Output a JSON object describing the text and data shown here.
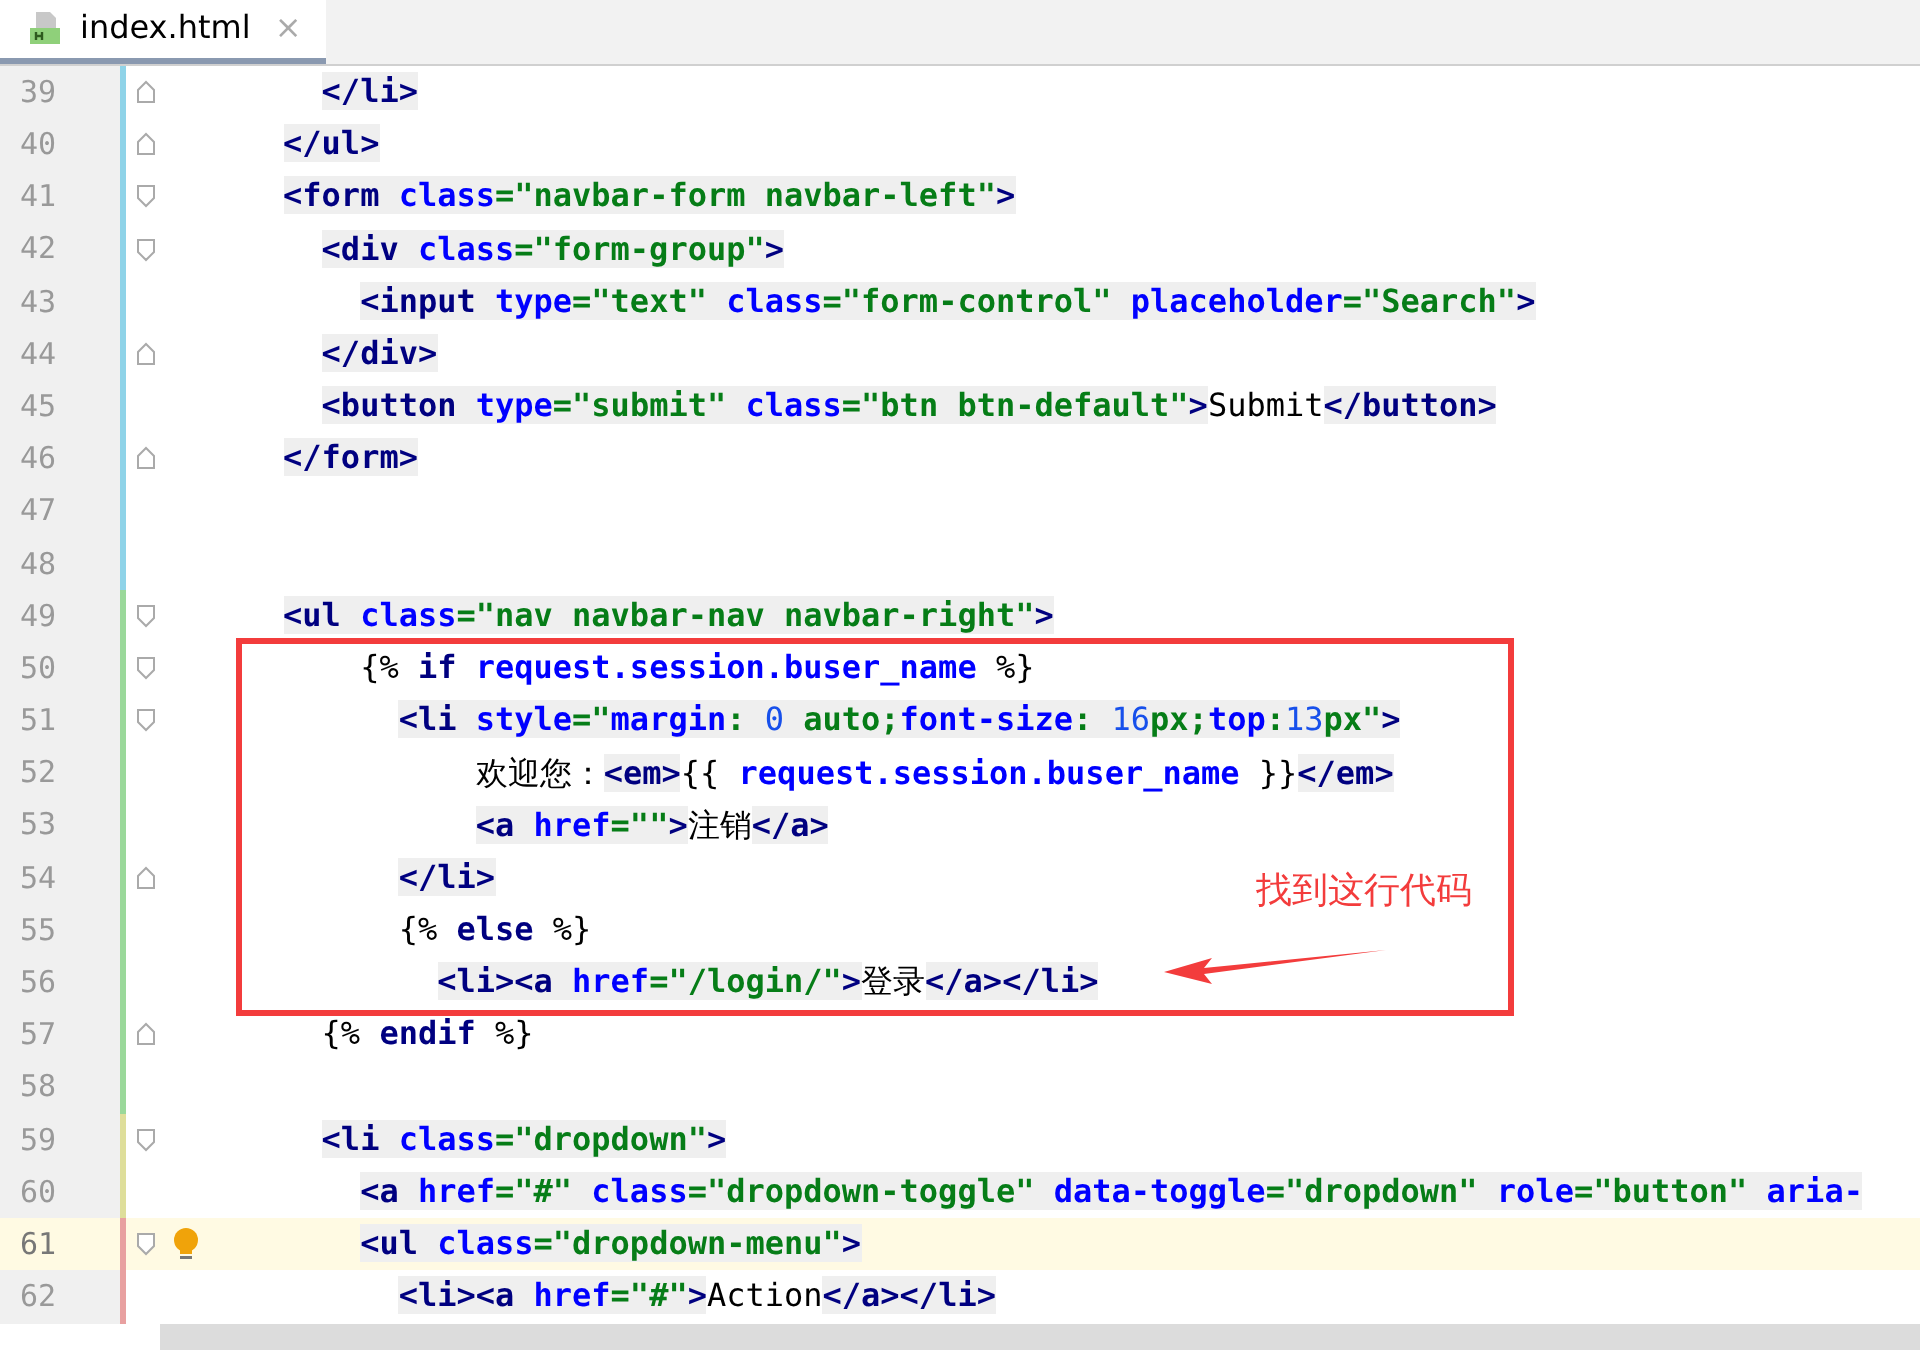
{
  "tab": {
    "title": "index.html",
    "close": "×",
    "selected": true
  },
  "lines": [
    {
      "number": "39",
      "color": "#8fd3e8",
      "kind": "closer",
      "current": false,
      "bulb": false,
      "tokens": [
        {
          "kind": "tag",
          "text": "      </li>"
        }
      ]
    },
    {
      "number": "40",
      "color": "#8fd3e8",
      "kind": "closer",
      "current": false,
      "bulb": false,
      "tokens": [
        {
          "kind": "tag",
          "text": "    </ul>"
        }
      ]
    },
    {
      "number": "41",
      "color": "#8fd3e8",
      "kind": "opener",
      "current": false,
      "bulb": false,
      "tokens": [
        {
          "kind": "tag",
          "text": "    <form"
        },
        {
          "kind": "attr",
          "text": " class"
        },
        {
          "kind": "str",
          "text": "=\"navbar-form navbar-left\""
        },
        {
          "kind": "tag",
          "text": ">"
        }
      ]
    },
    {
      "number": "42",
      "color": "#8fd3e8",
      "kind": "opener",
      "current": false,
      "bulb": false,
      "tokens": [
        {
          "kind": "tag",
          "text": "      <div"
        },
        {
          "kind": "attr",
          "text": " class"
        },
        {
          "kind": "str",
          "text": "=\"form-group\""
        },
        {
          "kind": "tag",
          "text": ">"
        }
      ]
    },
    {
      "number": "43",
      "color": "#8fd3e8",
      "kind": "plain",
      "current": false,
      "bulb": false,
      "tokens": [
        {
          "kind": "tag",
          "text": "        <input"
        },
        {
          "kind": "attr",
          "text": " type"
        },
        {
          "kind": "str",
          "text": "=\"text\""
        },
        {
          "kind": "attr",
          "text": " class"
        },
        {
          "kind": "str",
          "text": "=\"form-control\""
        },
        {
          "kind": "attr",
          "text": " placeholder"
        },
        {
          "kind": "str",
          "text": "=\"Search\""
        },
        {
          "kind": "tag",
          "text": ">"
        }
      ]
    },
    {
      "number": "44",
      "color": "#8fd3e8",
      "kind": "closer",
      "current": false,
      "bulb": false,
      "tokens": [
        {
          "kind": "tag",
          "text": "      </div>"
        }
      ]
    },
    {
      "number": "45",
      "color": "#8fd3e8",
      "kind": "plain",
      "current": false,
      "bulb": false,
      "tokens": [
        {
          "kind": "tag",
          "text": "      <button"
        },
        {
          "kind": "attr",
          "text": " type"
        },
        {
          "kind": "str",
          "text": "=\"submit\""
        },
        {
          "kind": "attr",
          "text": " class"
        },
        {
          "kind": "str",
          "text": "=\"btn btn-default\""
        },
        {
          "kind": "tag",
          "text": ">"
        },
        {
          "kind": "plain",
          "text": "Submit"
        },
        {
          "kind": "tag",
          "text": "</button>"
        }
      ]
    },
    {
      "number": "46",
      "color": "#8fd3e8",
      "kind": "closer",
      "current": false,
      "bulb": false,
      "tokens": [
        {
          "kind": "tag",
          "text": "    </form>"
        }
      ]
    },
    {
      "number": "47",
      "color": "#8fd3e8",
      "kind": "plain",
      "current": false,
      "bulb": false
    },
    {
      "number": "48",
      "color": "#8fd3e8",
      "kind": "plain",
      "current": false,
      "bulb": false
    },
    {
      "number": "49",
      "color": "#9ad89a",
      "kind": "opener",
      "current": false,
      "bulb": false,
      "tokens": [
        {
          "kind": "tag",
          "text": "    <ul"
        },
        {
          "kind": "attr",
          "text": " class"
        },
        {
          "kind": "str",
          "text": "=\"nav navbar-nav navbar-right\""
        },
        {
          "kind": "tag",
          "text": ">"
        }
      ]
    },
    {
      "number": "50",
      "color": "#9ad89a",
      "kind": "opener",
      "current": false,
      "bulb": false,
      "tokens": [
        {
          "kind": "plain",
          "text": "        {% "
        },
        {
          "kind": "kw",
          "text": "if"
        },
        {
          "kind": "var",
          "text": " request.session.buser_name"
        },
        {
          "kind": "plain",
          "text": " %}"
        }
      ]
    },
    {
      "number": "51",
      "color": "#9ad89a",
      "kind": "opener",
      "current": false,
      "bulb": false,
      "tokens": [
        {
          "kind": "tag",
          "text": "          <li"
        },
        {
          "kind": "attr",
          "text": " style"
        },
        {
          "kind": "str",
          "text": "=\""
        },
        {
          "kind": "prop",
          "text": "margin"
        },
        {
          "kind": "str",
          "text": ": "
        },
        {
          "kind": "num",
          "text": "0"
        },
        {
          "kind": "str",
          "text": " auto;"
        },
        {
          "kind": "prop",
          "text": "font-size"
        },
        {
          "kind": "str",
          "text": ": "
        },
        {
          "kind": "num",
          "text": "16"
        },
        {
          "kind": "str",
          "text": "px;"
        },
        {
          "kind": "prop",
          "text": "top"
        },
        {
          "kind": "str",
          "text": ":"
        },
        {
          "kind": "num",
          "text": "13"
        },
        {
          "kind": "str",
          "text": "px\""
        },
        {
          "kind": "tag",
          "text": ">"
        }
      ]
    },
    {
      "number": "52",
      "color": "#9ad89a",
      "kind": "plain",
      "current": false,
      "bulb": false,
      "tokens": [
        {
          "kind": "plain",
          "text": "              欢迎您："
        },
        {
          "kind": "tag",
          "text": "<em>"
        },
        {
          "kind": "plain",
          "text": "{{"
        },
        {
          "kind": "var",
          "text": " request.session.buser_name"
        },
        {
          "kind": "plain",
          "text": " }}"
        },
        {
          "kind": "tag",
          "text": "</em>"
        }
      ]
    },
    {
      "number": "53",
      "color": "#9ad89a",
      "kind": "plain",
      "current": false,
      "bulb": false,
      "tokens": [
        {
          "kind": "tag",
          "text": "              <a"
        },
        {
          "kind": "attr",
          "text": " href"
        },
        {
          "kind": "str",
          "text": "=\"\""
        },
        {
          "kind": "tag",
          "text": ">"
        },
        {
          "kind": "plain",
          "text": "注销"
        },
        {
          "kind": "tag",
          "text": "</a>"
        }
      ]
    },
    {
      "number": "54",
      "color": "#9ad89a",
      "kind": "closer",
      "current": false,
      "bulb": false,
      "tokens": [
        {
          "kind": "tag",
          "text": "          </li>"
        }
      ]
    },
    {
      "number": "55",
      "color": "#9ad89a",
      "kind": "plain",
      "current": false,
      "bulb": false,
      "tokens": [
        {
          "kind": "plain",
          "text": "          {% "
        },
        {
          "kind": "kw",
          "text": "else"
        },
        {
          "kind": "plain",
          "text": " %}"
        }
      ]
    },
    {
      "number": "56",
      "color": "#9ad89a",
      "kind": "plain",
      "current": false,
      "bulb": false,
      "tokens": [
        {
          "kind": "tag",
          "text": "            <li><a"
        },
        {
          "kind": "attr",
          "text": " href"
        },
        {
          "kind": "str",
          "text": "=\"/login/\""
        },
        {
          "kind": "tag",
          "text": ">"
        },
        {
          "kind": "plain",
          "text": "登录"
        },
        {
          "kind": "tag",
          "text": "</a></li>"
        }
      ]
    },
    {
      "number": "57",
      "color": "#9ad89a",
      "kind": "closer",
      "current": false,
      "bulb": false,
      "tokens": [
        {
          "kind": "plain",
          "text": "      {% "
        },
        {
          "kind": "kw",
          "text": "endif"
        },
        {
          "kind": "plain",
          "text": " %}"
        }
      ]
    },
    {
      "number": "58",
      "color": "#9ad89a",
      "kind": "plain",
      "current": false,
      "bulb": false
    },
    {
      "number": "59",
      "color": "#dede9a",
      "kind": "opener",
      "current": false,
      "bulb": false,
      "tokens": [
        {
          "kind": "tag",
          "text": "      <li"
        },
        {
          "kind": "attr",
          "text": " class"
        },
        {
          "kind": "str",
          "text": "=\"dropdown\""
        },
        {
          "kind": "tag",
          "text": ">"
        }
      ]
    },
    {
      "number": "60",
      "color": "#dede9a",
      "kind": "plain",
      "current": false,
      "bulb": false,
      "tokens": [
        {
          "kind": "tag",
          "text": "        <a"
        },
        {
          "kind": "attr",
          "text": " href"
        },
        {
          "kind": "str",
          "text": "=\"#\""
        },
        {
          "kind": "attr",
          "text": " class"
        },
        {
          "kind": "str",
          "text": "=\"dropdown-toggle\""
        },
        {
          "kind": "attr",
          "text": " data-toggle"
        },
        {
          "kind": "str",
          "text": "=\"dropdown\""
        },
        {
          "kind": "attr",
          "text": " role"
        },
        {
          "kind": "str",
          "text": "=\"button\""
        },
        {
          "kind": "attr",
          "text": " aria-"
        }
      ]
    },
    {
      "number": "61",
      "color": "#e8a0a0",
      "kind": "opener",
      "current": true,
      "bulb": true,
      "tokens": [
        {
          "kind": "tag",
          "text": "        <ul"
        },
        {
          "kind": "attr",
          "text": " class"
        },
        {
          "kind": "str",
          "text": "=\"dropdown-menu\""
        },
        {
          "kind": "tag",
          "text": ">"
        }
      ]
    },
    {
      "number": "62",
      "color": "#e8a0a0",
      "kind": "plain",
      "current": false,
      "bulb": false,
      "tokens": [
        {
          "kind": "tag",
          "text": "          <li><a"
        },
        {
          "kind": "attr",
          "text": " href"
        },
        {
          "kind": "str",
          "text": "=\"#\""
        },
        {
          "kind": "tag",
          "text": ">"
        },
        {
          "kind": "plain",
          "text": "Action"
        },
        {
          "kind": "tag",
          "text": "</a></li>"
        }
      ]
    }
  ],
  "annotation": {
    "note": "找到这行代码"
  }
}
